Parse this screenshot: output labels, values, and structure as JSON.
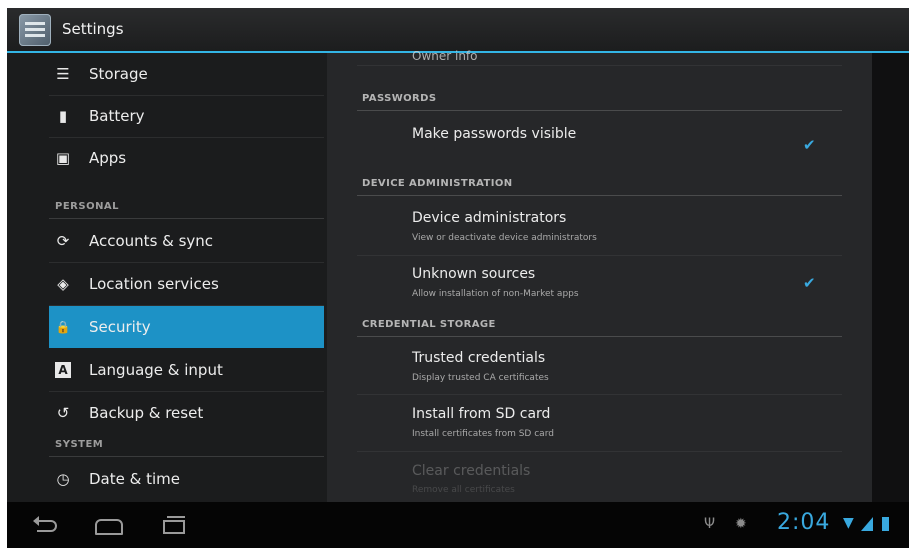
{
  "app": {
    "title": "Settings",
    "icon": "settings-app-icon"
  },
  "left_panel": {
    "items_top": [
      {
        "label": "Storage",
        "icon": "storage-icon",
        "glyph": "☰"
      },
      {
        "label": "Battery",
        "icon": "battery-icon",
        "glyph": "▮"
      },
      {
        "label": "Apps",
        "icon": "apps-icon",
        "glyph": "▣"
      }
    ],
    "section_personal": "PERSONAL",
    "items_personal": [
      {
        "label": "Accounts & sync",
        "icon": "sync-icon",
        "glyph": "⟳"
      },
      {
        "label": "Location services",
        "icon": "location-icon",
        "glyph": "◈"
      },
      {
        "label": "Security",
        "icon": "lock-icon",
        "glyph": "🔒",
        "selected": true
      },
      {
        "label": "Language & input",
        "icon": "language-icon",
        "glyph": "A"
      },
      {
        "label": "Backup & reset",
        "icon": "backup-icon",
        "glyph": "↺"
      }
    ],
    "section_system": "SYSTEM",
    "items_system": [
      {
        "label": "Date & time",
        "icon": "clock-icon",
        "glyph": "◷"
      }
    ]
  },
  "right_panel": {
    "cut_off_top": "Owner info",
    "passwords": {
      "header": "PASSWORDS",
      "make_visible": {
        "title": "Make passwords visible",
        "checked": true
      }
    },
    "device_admin": {
      "header": "DEVICE ADMINISTRATION",
      "administrators": {
        "title": "Device administrators",
        "subtitle": "View or deactivate device administrators"
      },
      "unknown_sources": {
        "title": "Unknown sources",
        "subtitle": "Allow installation of non-Market apps",
        "checked": true
      }
    },
    "credential_storage": {
      "header": "CREDENTIAL STORAGE",
      "trusted": {
        "title": "Trusted credentials",
        "subtitle": "Display trusted CA certificates"
      },
      "install": {
        "title": "Install from SD card",
        "subtitle": "Install certificates from SD card"
      },
      "clear": {
        "title": "Clear credentials",
        "subtitle": "Remove all certificates",
        "disabled": true
      }
    }
  },
  "status_bar": {
    "time": "2:04",
    "accent": "#33b5e5"
  }
}
